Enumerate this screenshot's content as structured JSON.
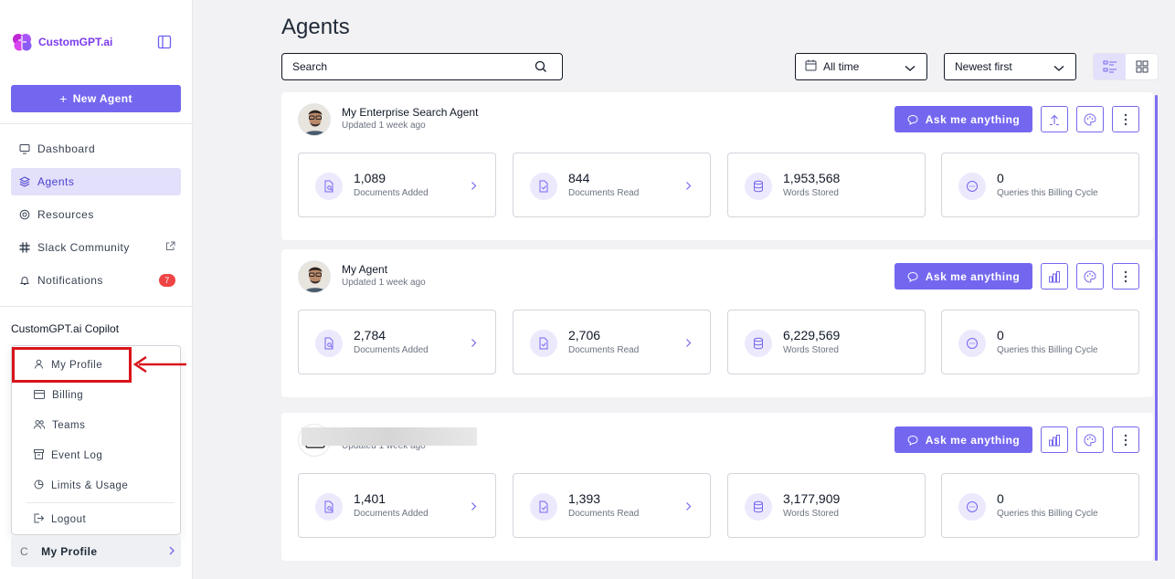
{
  "sidebar": {
    "brand": "CustomGPT.ai",
    "new_agent_label": "New Agent",
    "nav": [
      {
        "label": "Dashboard",
        "icon": "dashboard-icon"
      },
      {
        "label": "Agents",
        "icon": "layers-icon",
        "active": true
      },
      {
        "label": "Resources",
        "icon": "lifebuoy-icon"
      },
      {
        "label": "Slack Community",
        "icon": "slack-icon"
      },
      {
        "label": "Notifications",
        "icon": "bell-icon",
        "badge": "7"
      }
    ],
    "copilot_label": "CustomGPT.ai Copilot",
    "profile_menu": [
      {
        "label": "My Profile",
        "icon": "user-icon"
      },
      {
        "label": "Billing",
        "icon": "credit-card-icon"
      },
      {
        "label": "Teams",
        "icon": "users-icon"
      },
      {
        "label": "Event Log",
        "icon": "archive-icon"
      },
      {
        "label": "Limits & Usage",
        "icon": "pie-chart-icon"
      },
      {
        "label": "Logout",
        "icon": "logout-icon"
      }
    ],
    "profile_bar": {
      "initial": "C",
      "label": "My Profile"
    }
  },
  "main": {
    "title": "Agents",
    "search": {
      "value": "Search"
    },
    "filters": {
      "time": "All time",
      "sort": "Newest first"
    },
    "ask_label": "Ask me anything",
    "agents": [
      {
        "name": "My Enterprise Search Agent",
        "updated": "Updated 1 week ago",
        "stats": [
          {
            "value": "1,089",
            "label": "Documents Added"
          },
          {
            "value": "844",
            "label": "Documents Read"
          },
          {
            "value": "1,953,568",
            "label": "Words Stored"
          },
          {
            "value": "0",
            "label": "Queries this Billing Cycle"
          }
        ]
      },
      {
        "name": "My Agent",
        "updated": "Updated 1 week ago",
        "stats": [
          {
            "value": "2,784",
            "label": "Documents Added"
          },
          {
            "value": "2,706",
            "label": "Documents Read"
          },
          {
            "value": "6,229,569",
            "label": "Words Stored"
          },
          {
            "value": "0",
            "label": "Queries this Billing Cycle"
          }
        ]
      },
      {
        "name": "",
        "updated": "Updated 1 week ago",
        "stats": [
          {
            "value": "1,401",
            "label": "Documents Added"
          },
          {
            "value": "1,393",
            "label": "Documents Read"
          },
          {
            "value": "3,177,909",
            "label": "Words Stored"
          },
          {
            "value": "0",
            "label": "Queries this Billing Cycle"
          }
        ]
      }
    ]
  },
  "colors": {
    "accent": "#7467ef",
    "accent_soft": "#e3e0fb",
    "highlight": "#d9141b"
  }
}
